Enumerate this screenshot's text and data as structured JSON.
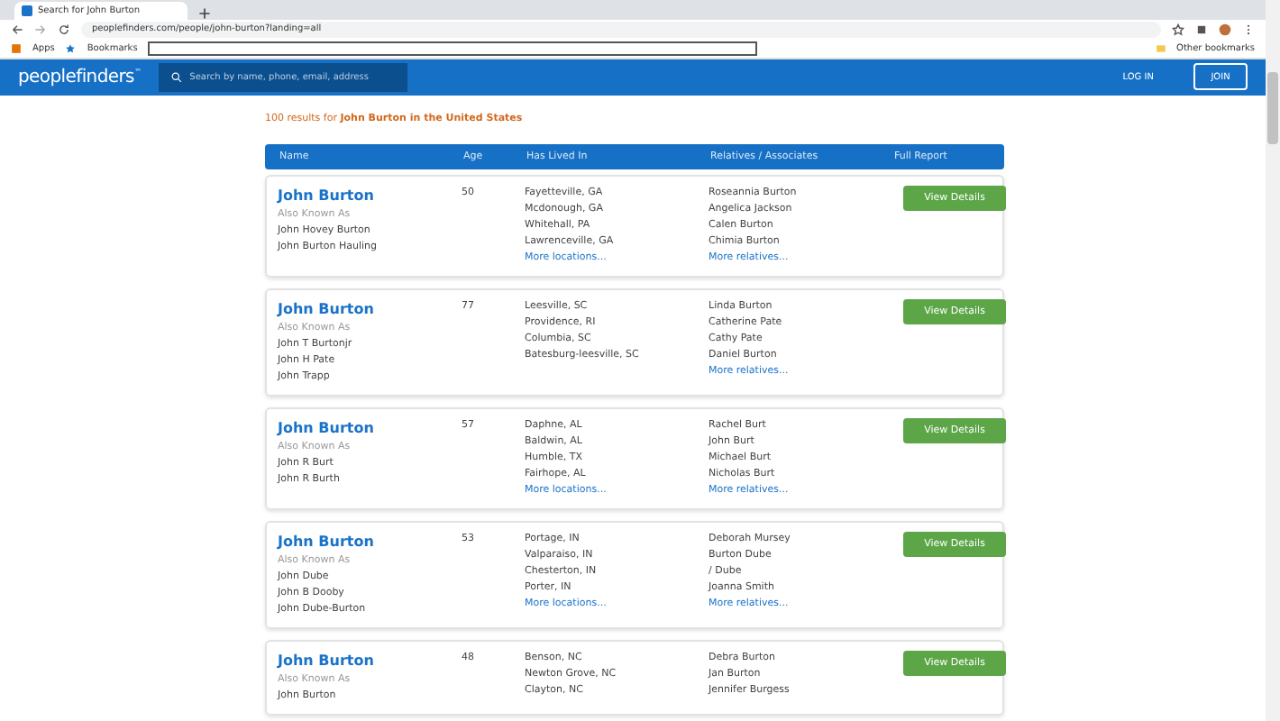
{
  "browser": {
    "tab_title": "Search for John Burton",
    "url": "peoplefinders.com/people/john-burton?landing=all",
    "bookmarks": [
      "Apps",
      "Bookmarks"
    ],
    "other_bookmarks": "Other bookmarks"
  },
  "header": {
    "logo": "peoplefinders",
    "logo_mark": "™",
    "search": {
      "placeholder": "Search by name, phone, email, address"
    },
    "login": "LOG IN",
    "join": "JOIN"
  },
  "summary": {
    "count": "100 results for ",
    "query": "John Burton in the United States"
  },
  "table": {
    "columns": [
      "Name",
      "Age",
      "Has Lived In",
      "Relatives / Associates",
      "Full Report"
    ],
    "rows": [
      {
        "name": "John Burton",
        "aka_label": "Also Known As",
        "aka": [
          "John Hovey Burton",
          "John Burton Hauling"
        ],
        "age": "50",
        "places": [
          "Fayetteville, GA",
          "Mcdonough, GA",
          "Whitehall, PA",
          "Lawrenceville, GA"
        ],
        "more_places": "More locations...",
        "relatives": [
          "Roseannia Burton",
          "Angelica Jackson",
          "Calen Burton",
          "Chimia Burton"
        ],
        "more_relatives": "More relatives...",
        "button": "View Details"
      },
      {
        "name": "John Burton",
        "aka_label": "Also Known As",
        "aka": [
          "John T Burtonjr",
          "John H Pate",
          "John Trapp"
        ],
        "age": "77",
        "places": [
          "Leesville, SC",
          "Providence, RI",
          "Columbia, SC",
          "Batesburg-leesville, SC"
        ],
        "relatives": [
          "Linda Burton",
          "Catherine Pate",
          "Cathy Pate",
          "Daniel Burton"
        ],
        "more_relatives": "More relatives...",
        "button": "View Details"
      },
      {
        "name": "John Burton",
        "aka_label": "Also Known As",
        "aka": [
          "John R Burt",
          "John R Burth"
        ],
        "age": "57",
        "places": [
          "Daphne, AL",
          "Baldwin, AL",
          "Humble, TX",
          "Fairhope, AL"
        ],
        "more_places": "More locations...",
        "relatives": [
          "Rachel Burt",
          "John Burt",
          "Michael Burt",
          "Nicholas Burt"
        ],
        "more_relatives": "More relatives...",
        "button": "View Details"
      },
      {
        "name": "John Burton",
        "aka_label": "Also Known As",
        "aka": [
          "John Dube",
          "John B Dooby",
          "John Dube-Burton"
        ],
        "age": "53",
        "places": [
          "Portage, IN",
          "Valparaiso, IN",
          "Chesterton, IN",
          "Porter, IN"
        ],
        "more_places": "More locations...",
        "relatives": [
          "Deborah Mursey",
          "Burton Dube",
          "/ Dube",
          "Joanna Smith"
        ],
        "more_relatives": "More relatives...",
        "button": "View Details"
      },
      {
        "name": "John Burton",
        "aka_label": "Also Known As",
        "aka": [
          "John Burton"
        ],
        "age": "48",
        "places": [
          "Benson, NC",
          "Newton Grove, NC",
          "Clayton, NC"
        ],
        "relatives": [
          "Debra Burton",
          "Jan Burton",
          "Jennifer Burgess"
        ],
        "button": "View Details"
      }
    ]
  }
}
